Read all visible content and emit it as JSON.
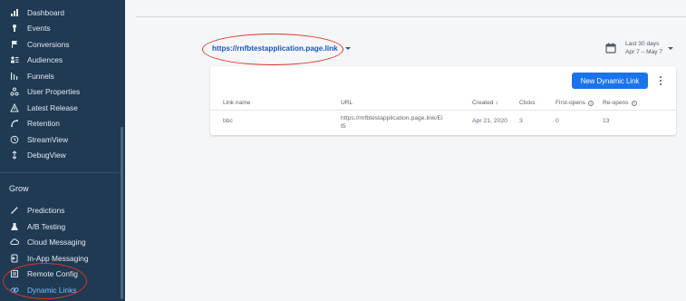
{
  "sidebar": {
    "items": [
      {
        "label": "Dashboard",
        "icon": "bar-chart-icon"
      },
      {
        "label": "Events",
        "icon": "events-icon"
      },
      {
        "label": "Conversions",
        "icon": "flag-icon"
      },
      {
        "label": "Audiences",
        "icon": "audiences-icon"
      },
      {
        "label": "Funnels",
        "icon": "funnels-icon"
      },
      {
        "label": "User Properties",
        "icon": "user-properties-icon"
      },
      {
        "label": "Latest Release",
        "icon": "latest-release-icon"
      },
      {
        "label": "Retention",
        "icon": "retention-icon"
      },
      {
        "label": "StreamView",
        "icon": "clock-icon"
      },
      {
        "label": "DebugView",
        "icon": "debug-icon"
      }
    ],
    "grow": {
      "title": "Grow",
      "items": [
        {
          "label": "Predictions",
          "icon": "wand-icon"
        },
        {
          "label": "A/B Testing",
          "icon": "flask-icon"
        },
        {
          "label": "Cloud Messaging",
          "icon": "cloud-messaging-icon"
        },
        {
          "label": "In-App Messaging",
          "icon": "in-app-messaging-icon"
        },
        {
          "label": "Remote Config",
          "icon": "remote-config-icon"
        },
        {
          "label": "Dynamic Links",
          "icon": "link-icon"
        }
      ]
    },
    "active_item": "Dynamic Links",
    "colors": {
      "background": "#1f3a52",
      "active_text": "#7fc0ff"
    }
  },
  "main": {
    "url_selector": {
      "value": "https://rnfbtestapplication.page.link"
    },
    "date_range": {
      "label": "Last 30 days",
      "range": "Apr 7 – May 7"
    },
    "new_button": {
      "label": "New Dynamic Link"
    },
    "table": {
      "columns": [
        "Link name",
        "URL",
        "Created",
        "Clicks",
        "First-opens",
        "Re-opens"
      ],
      "sort_indicator": "↓",
      "rows": [
        {
          "link_name": "bbc",
          "url_line1": "https://rnfbtestapplication.page.link/Ei",
          "url_line2": "t5",
          "created": "Apr 21, 2020",
          "clicks": "3",
          "first_opens": "0",
          "re_opens": "13"
        }
      ]
    },
    "colors": {
      "accent": "#1a73e8",
      "annotation_ellipse": "#d6362a"
    }
  }
}
